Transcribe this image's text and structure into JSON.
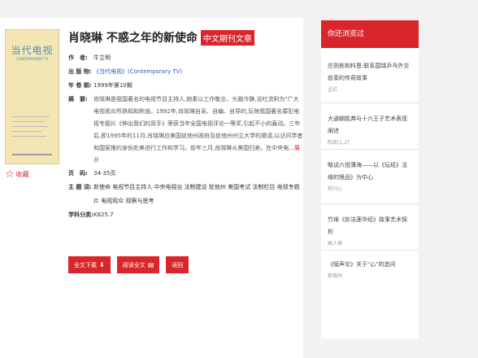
{
  "article": {
    "title": "肖晓琳 不惑之年的新使命",
    "tag": "中文期刊文章",
    "favorite_label": "收藏",
    "cover": {
      "title": "当代电视",
      "subtitle": "CONTEMPORARY TV"
    },
    "fields": {
      "author_label": "作　者:",
      "author": "牛立明",
      "publication_label": "出 版 物:",
      "publication": "《当代电视》(Contemporary TV)",
      "year_label": "年 卷 期:",
      "year": "1999年第10期",
      "abstract_label": "摘　要:",
      "abstract": "肖晓琳是我国著名的电视节目主持人,她素以工作敬业、头脑冷静,谈吐流利为\"广大电视观众所熟知和称道。1992年,肖晓琳自采、自编、自导的,反映我国著名罪犯电视专题片《伸出我们的双手》荣获当年全国电视评论一等奖,引起不小的轰动。三年后,即1995年的11月,肖晓琳应美国犹他州政府及犹他州州立大学的邀请,以访问学者和国家推的身份赴美进行工作和学习。前年三月,肖晓琳从美国归来。在中央电...",
      "more_label": "展开",
      "pages_label": "页　码:",
      "pages": "34-35页",
      "keywords_label": "主 题 词:",
      "keywords": "新使命 电视节目主持人 中央电视台 法制建设 犹他州 美国考试 法制栏目 电视专题片 电视观众 观察与思考",
      "class_label": "学科分类:",
      "class": "K825.7"
    },
    "buttons": {
      "download": "全文下载",
      "read": "阅读全文",
      "back": "返回"
    }
  },
  "sidebar": {
    "heading": "你还浏览过",
    "items": [
      {
        "title": "庄则栋和科恩:联系国球乒乓外交前奏的传奇故事",
        "author": "孟红"
      },
      {
        "title": "大通朝胜弗与十六王子艺术表现阐述",
        "author": "陈凯[1,2]"
      },
      {
        "title": "略谈六祖薄海——以《坛经》法缘的根品》为中心",
        "author": "程兴心"
      },
      {
        "title": "竹禅《妙法莲华经》故事艺术探析",
        "author": "高人泰"
      },
      {
        "title": "《赋声论》关于\"心\"的追问",
        "author": "郭德同"
      }
    ]
  }
}
